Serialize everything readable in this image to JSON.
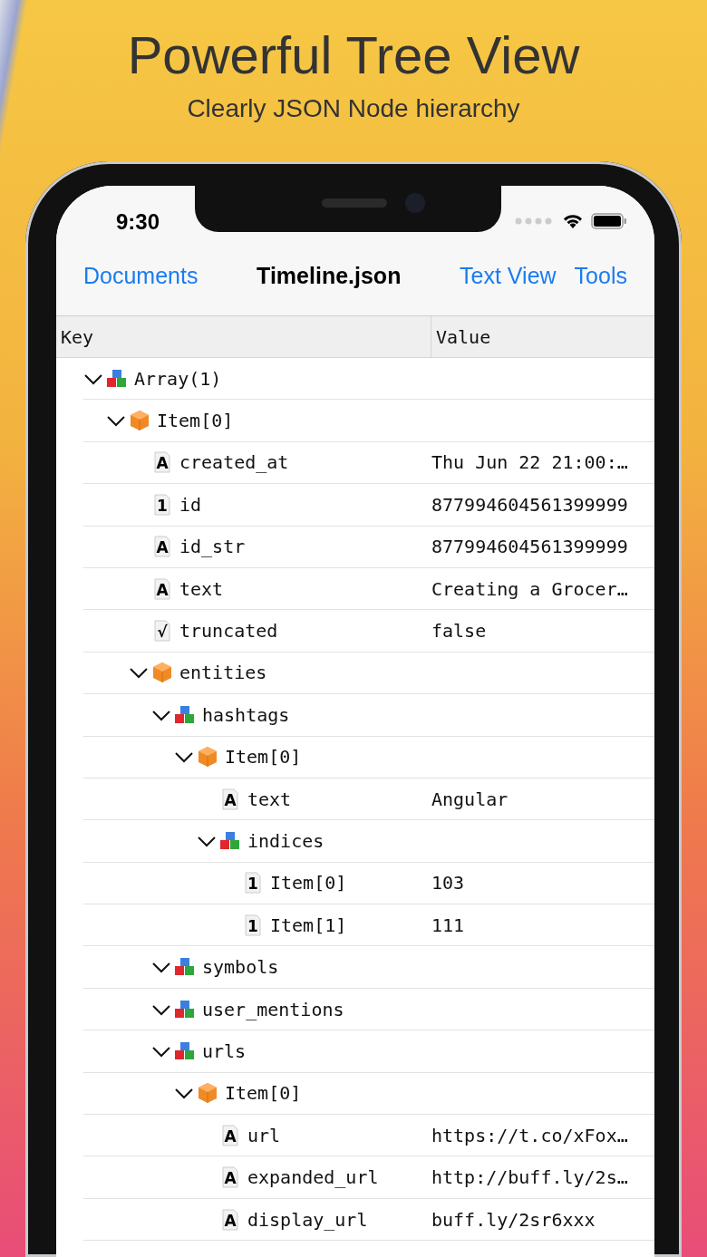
{
  "promo": {
    "title": "Powerful Tree View",
    "subtitle": "Clearly JSON Node hierarchy"
  },
  "status_bar": {
    "time": "9:30"
  },
  "nav_bar": {
    "back": "Documents",
    "title": "Timeline.json",
    "actions": [
      "Text View",
      "Tools"
    ]
  },
  "table": {
    "columns": [
      "Key",
      "Value"
    ],
    "tree": [
      {
        "kind": "array",
        "key": "Array(1)",
        "expanded": true,
        "children": [
          {
            "kind": "object",
            "key": "Item[0]",
            "expanded": true,
            "children": [
              {
                "kind": "value",
                "type_mark": "A",
                "key": "created_at",
                "value": "Thu Jun 22 21:00:…"
              },
              {
                "kind": "value",
                "type_mark": "1",
                "key": "id",
                "value": "877994604561399999"
              },
              {
                "kind": "value",
                "type_mark": "A",
                "key": "id_str",
                "value": "877994604561399999"
              },
              {
                "kind": "value",
                "type_mark": "A",
                "key": "text",
                "value": "Creating a Grocer…"
              },
              {
                "kind": "value",
                "type_mark": "√",
                "key": "truncated",
                "value": "false"
              },
              {
                "kind": "object",
                "key": "entities",
                "expanded": true,
                "children": [
                  {
                    "kind": "array",
                    "key": "hashtags",
                    "expanded": true,
                    "children": [
                      {
                        "kind": "object",
                        "key": "Item[0]",
                        "expanded": true,
                        "children": [
                          {
                            "kind": "value",
                            "type_mark": "A",
                            "key": "text",
                            "value": "Angular"
                          },
                          {
                            "kind": "array",
                            "key": "indices",
                            "expanded": true,
                            "children": [
                              {
                                "kind": "value",
                                "type_mark": "1",
                                "key": "Item[0]",
                                "value": "103"
                              },
                              {
                                "kind": "value",
                                "type_mark": "1",
                                "key": "Item[1]",
                                "value": "111"
                              }
                            ]
                          }
                        ]
                      }
                    ]
                  },
                  {
                    "kind": "array",
                    "key": "symbols",
                    "expanded": true
                  },
                  {
                    "kind": "array",
                    "key": "user_mentions",
                    "expanded": true
                  },
                  {
                    "kind": "array",
                    "key": "urls",
                    "expanded": true,
                    "children": [
                      {
                        "kind": "object",
                        "key": "Item[0]",
                        "expanded": true,
                        "children": [
                          {
                            "kind": "value",
                            "type_mark": "A",
                            "key": "url",
                            "value": "https://t.co/xFox…"
                          },
                          {
                            "kind": "value",
                            "type_mark": "A",
                            "key": "expanded_url",
                            "value": "http://buff.ly/2s…"
                          },
                          {
                            "kind": "value",
                            "type_mark": "A",
                            "key": "display_url",
                            "value": "buff.ly/2sr6xxx"
                          }
                        ]
                      }
                    ]
                  }
                ]
              }
            ]
          }
        ]
      }
    ]
  }
}
